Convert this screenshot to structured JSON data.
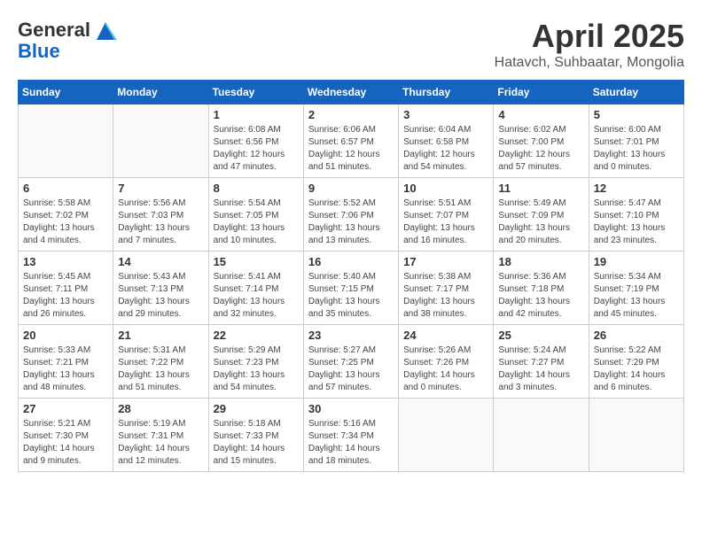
{
  "header": {
    "logo_line1": "General",
    "logo_line2": "Blue",
    "month": "April 2025",
    "location": "Hatavch, Suhbaatar, Mongolia"
  },
  "weekdays": [
    "Sunday",
    "Monday",
    "Tuesday",
    "Wednesday",
    "Thursday",
    "Friday",
    "Saturday"
  ],
  "weeks": [
    [
      {
        "day": "",
        "info": ""
      },
      {
        "day": "",
        "info": ""
      },
      {
        "day": "1",
        "info": "Sunrise: 6:08 AM\nSunset: 6:56 PM\nDaylight: 12 hours and 47 minutes."
      },
      {
        "day": "2",
        "info": "Sunrise: 6:06 AM\nSunset: 6:57 PM\nDaylight: 12 hours and 51 minutes."
      },
      {
        "day": "3",
        "info": "Sunrise: 6:04 AM\nSunset: 6:58 PM\nDaylight: 12 hours and 54 minutes."
      },
      {
        "day": "4",
        "info": "Sunrise: 6:02 AM\nSunset: 7:00 PM\nDaylight: 12 hours and 57 minutes."
      },
      {
        "day": "5",
        "info": "Sunrise: 6:00 AM\nSunset: 7:01 PM\nDaylight: 13 hours and 0 minutes."
      }
    ],
    [
      {
        "day": "6",
        "info": "Sunrise: 5:58 AM\nSunset: 7:02 PM\nDaylight: 13 hours and 4 minutes."
      },
      {
        "day": "7",
        "info": "Sunrise: 5:56 AM\nSunset: 7:03 PM\nDaylight: 13 hours and 7 minutes."
      },
      {
        "day": "8",
        "info": "Sunrise: 5:54 AM\nSunset: 7:05 PM\nDaylight: 13 hours and 10 minutes."
      },
      {
        "day": "9",
        "info": "Sunrise: 5:52 AM\nSunset: 7:06 PM\nDaylight: 13 hours and 13 minutes."
      },
      {
        "day": "10",
        "info": "Sunrise: 5:51 AM\nSunset: 7:07 PM\nDaylight: 13 hours and 16 minutes."
      },
      {
        "day": "11",
        "info": "Sunrise: 5:49 AM\nSunset: 7:09 PM\nDaylight: 13 hours and 20 minutes."
      },
      {
        "day": "12",
        "info": "Sunrise: 5:47 AM\nSunset: 7:10 PM\nDaylight: 13 hours and 23 minutes."
      }
    ],
    [
      {
        "day": "13",
        "info": "Sunrise: 5:45 AM\nSunset: 7:11 PM\nDaylight: 13 hours and 26 minutes."
      },
      {
        "day": "14",
        "info": "Sunrise: 5:43 AM\nSunset: 7:13 PM\nDaylight: 13 hours and 29 minutes."
      },
      {
        "day": "15",
        "info": "Sunrise: 5:41 AM\nSunset: 7:14 PM\nDaylight: 13 hours and 32 minutes."
      },
      {
        "day": "16",
        "info": "Sunrise: 5:40 AM\nSunset: 7:15 PM\nDaylight: 13 hours and 35 minutes."
      },
      {
        "day": "17",
        "info": "Sunrise: 5:38 AM\nSunset: 7:17 PM\nDaylight: 13 hours and 38 minutes."
      },
      {
        "day": "18",
        "info": "Sunrise: 5:36 AM\nSunset: 7:18 PM\nDaylight: 13 hours and 42 minutes."
      },
      {
        "day": "19",
        "info": "Sunrise: 5:34 AM\nSunset: 7:19 PM\nDaylight: 13 hours and 45 minutes."
      }
    ],
    [
      {
        "day": "20",
        "info": "Sunrise: 5:33 AM\nSunset: 7:21 PM\nDaylight: 13 hours and 48 minutes."
      },
      {
        "day": "21",
        "info": "Sunrise: 5:31 AM\nSunset: 7:22 PM\nDaylight: 13 hours and 51 minutes."
      },
      {
        "day": "22",
        "info": "Sunrise: 5:29 AM\nSunset: 7:23 PM\nDaylight: 13 hours and 54 minutes."
      },
      {
        "day": "23",
        "info": "Sunrise: 5:27 AM\nSunset: 7:25 PM\nDaylight: 13 hours and 57 minutes."
      },
      {
        "day": "24",
        "info": "Sunrise: 5:26 AM\nSunset: 7:26 PM\nDaylight: 14 hours and 0 minutes."
      },
      {
        "day": "25",
        "info": "Sunrise: 5:24 AM\nSunset: 7:27 PM\nDaylight: 14 hours and 3 minutes."
      },
      {
        "day": "26",
        "info": "Sunrise: 5:22 AM\nSunset: 7:29 PM\nDaylight: 14 hours and 6 minutes."
      }
    ],
    [
      {
        "day": "27",
        "info": "Sunrise: 5:21 AM\nSunset: 7:30 PM\nDaylight: 14 hours and 9 minutes."
      },
      {
        "day": "28",
        "info": "Sunrise: 5:19 AM\nSunset: 7:31 PM\nDaylight: 14 hours and 12 minutes."
      },
      {
        "day": "29",
        "info": "Sunrise: 5:18 AM\nSunset: 7:33 PM\nDaylight: 14 hours and 15 minutes."
      },
      {
        "day": "30",
        "info": "Sunrise: 5:16 AM\nSunset: 7:34 PM\nDaylight: 14 hours and 18 minutes."
      },
      {
        "day": "",
        "info": ""
      },
      {
        "day": "",
        "info": ""
      },
      {
        "day": "",
        "info": ""
      }
    ]
  ]
}
